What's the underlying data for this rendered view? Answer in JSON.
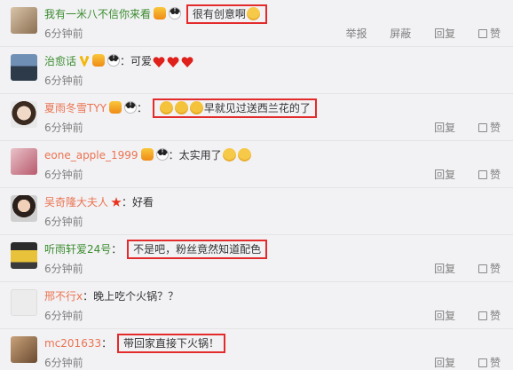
{
  "labels": {
    "reply": "回复",
    "like": "赞",
    "report": "举报",
    "block": "屏蔽",
    "colon": "："
  },
  "comments": [
    {
      "user": "我有一米八不信你来看",
      "time": "6分钟前",
      "text": "很有创意啊",
      "highlight": true,
      "extra_actions": true
    },
    {
      "user": "治愈话",
      "time": "6分钟前",
      "text": "可爱",
      "highlight": false
    },
    {
      "user": "夏雨冬雪TYY",
      "time": "6分钟前",
      "text": "早就见过送西兰花的了",
      "highlight": true
    },
    {
      "user": "eone_apple_1999",
      "time": "6分钟前",
      "text": "太实用了",
      "highlight": false
    },
    {
      "user": "吴奇隆大夫人",
      "time": "6分钟前",
      "text": "好看",
      "highlight": false
    },
    {
      "user": "听雨轩爱24号",
      "time": "6分钟前",
      "text": "不是吧，粉丝竟然知道配色",
      "highlight": true
    },
    {
      "user": "邢不行x",
      "time": "6分钟前",
      "text": "晚上吃个火锅？？",
      "highlight": false
    },
    {
      "user": "mc201633",
      "time": "6分钟前",
      "text": "带回家直接下火锅！",
      "highlight": true
    }
  ],
  "colors": {
    "username": "#eb7350",
    "highlight_border": "#e32b2b",
    "meta": "#808080"
  },
  "icons": [
    "vip-badge-icon",
    "panda-badge-icon",
    "verified-v-icon",
    "star-badge-icon",
    "thumb-up-icon",
    "emoji-icon",
    "heart-icon"
  ]
}
